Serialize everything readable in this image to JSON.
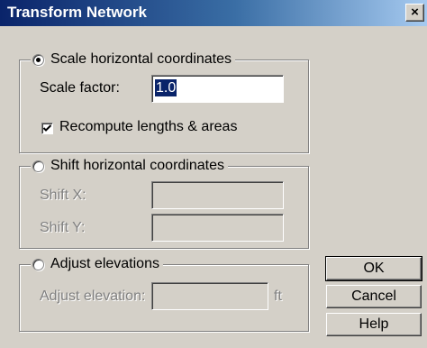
{
  "window": {
    "title": "Transform Network",
    "close_glyph": "×"
  },
  "scale_group": {
    "label": "Scale horizontal coordinates",
    "selected": true,
    "factor_label": "Scale factor:",
    "factor_value": "1.0",
    "recompute_label": "Recompute lengths & areas",
    "recompute_checked": true
  },
  "shift_group": {
    "label": "Shift horizontal coordinates",
    "selected": false,
    "shift_x_label": "Shift X:",
    "shift_x_value": "",
    "shift_y_label": "Shift Y:",
    "shift_y_value": ""
  },
  "elev_group": {
    "label": "Adjust elevations",
    "selected": false,
    "adjust_label": "Adjust elevation:",
    "adjust_value": "",
    "unit": "ft"
  },
  "buttons": {
    "ok": "OK",
    "cancel": "Cancel",
    "help": "Help"
  },
  "icons": {
    "close": "close-icon",
    "check": "checkmark-icon",
    "radio": "radio-dot-icon"
  }
}
